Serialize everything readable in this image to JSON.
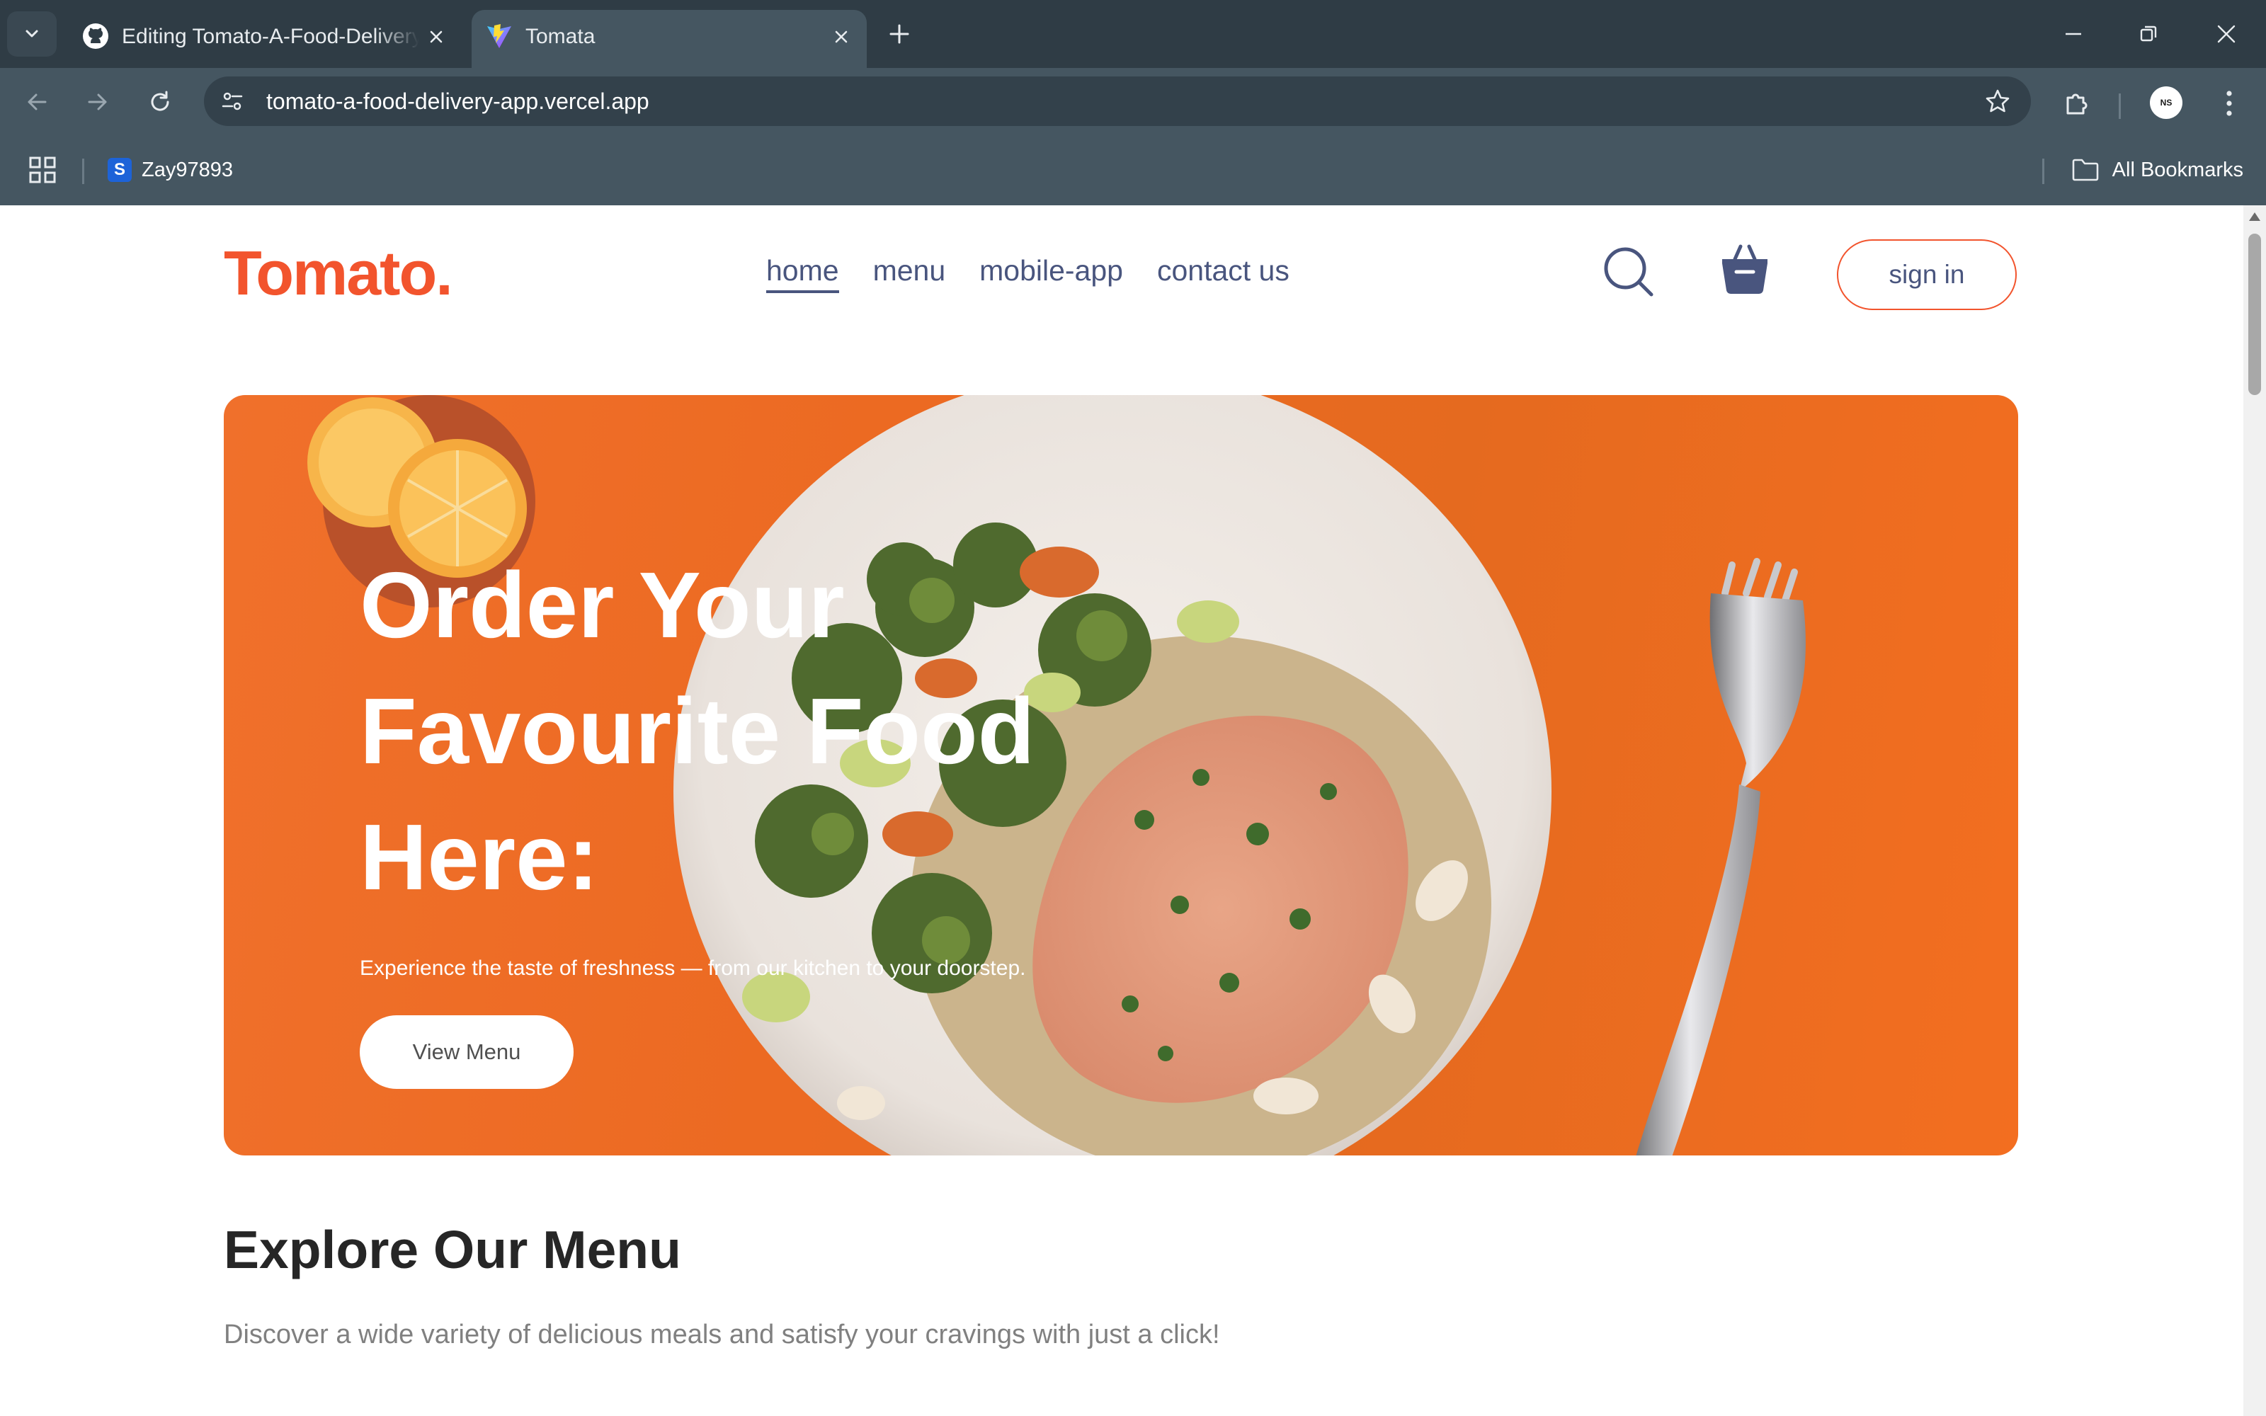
{
  "browser": {
    "tabs": [
      {
        "title": "Editing Tomato-A-Food-Delivery-App/README.md",
        "active": false,
        "favicon": "github-icon"
      },
      {
        "title": "Tomata",
        "active": true,
        "favicon": "vite-icon"
      }
    ],
    "url": "tomato-a-food-delivery-app.vercel.app",
    "bookmarks": [
      {
        "label": "Zay97893",
        "icon_letter": "S"
      }
    ],
    "all_bookmarks_label": "All Bookmarks",
    "profile_initials": "NS"
  },
  "site": {
    "logo": "Tomato.",
    "nav": [
      "home",
      "menu",
      "mobile-app",
      "contact us"
    ],
    "active_nav": "home",
    "sign_in_label": "sign in",
    "brand_color": "#f2542d",
    "text_color": "#49557e"
  },
  "hero": {
    "title_lines": [
      "Order Your",
      "Favourite Food",
      "Here:"
    ],
    "subtitle": "Experience the taste of freshness — from our kitchen to your doorstep.",
    "button_label": "View Menu"
  },
  "explore": {
    "title": "Explore Our Menu",
    "text": "Discover a wide variety of delicious meals and satisfy your cravings with just a click!"
  }
}
